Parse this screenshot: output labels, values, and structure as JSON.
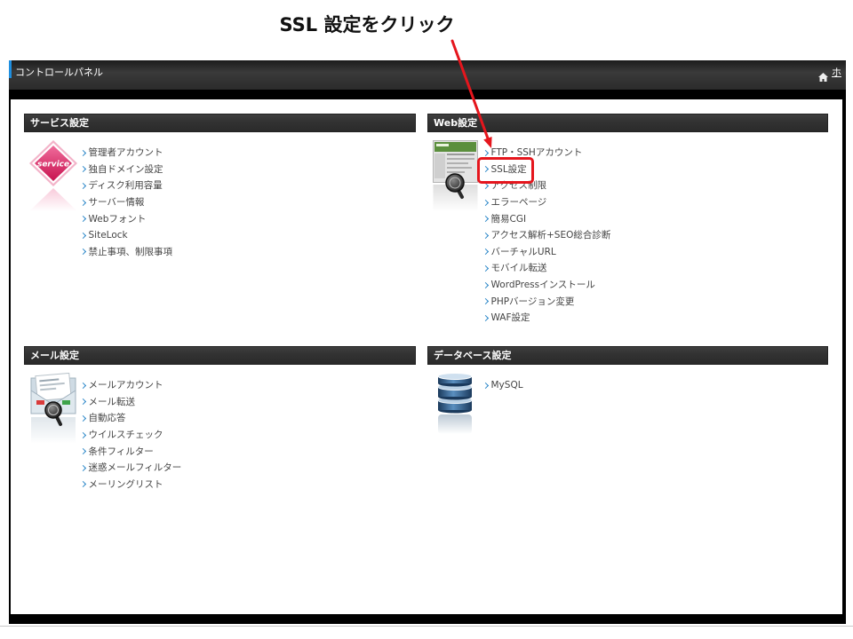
{
  "annotation": {
    "instruction": "SSL 設定をクリック"
  },
  "header": {
    "title": "コントロールパネル",
    "home_icon": "home-icon",
    "home_link": "ホ"
  },
  "sections": {
    "service": {
      "title": "サービス設定",
      "icon": "service-diamond-icon",
      "icon_text": "service",
      "links": [
        "管理者アカウント",
        "独自ドメイン設定",
        "ディスク利用容量",
        "サーバー情報",
        "Webフォント",
        "SiteLock",
        "禁止事項、制限事項"
      ]
    },
    "web": {
      "title": "Web設定",
      "icon": "web-page-magnifier-icon",
      "highlighted_link_index": 1,
      "links": [
        "FTP・SSHアカウント",
        "SSL設定",
        "アクセス制限",
        "エラーページ",
        "簡易CGI",
        "アクセス解析+SEO総合診断",
        "バーチャルURL",
        "モバイル転送",
        "WordPressインストール",
        "PHPバージョン変更",
        "WAF設定"
      ]
    },
    "mail": {
      "title": "メール設定",
      "icon": "mail-envelope-icon",
      "links": [
        "メールアカウント",
        "メール転送",
        "自動応答",
        "ウイルスチェック",
        "条件フィルター",
        "迷惑メールフィルター",
        "メーリングリスト"
      ]
    },
    "database": {
      "title": "データベース設定",
      "icon": "database-icon",
      "links": [
        "MySQL"
      ]
    }
  },
  "colors": {
    "annotation_red": "#e5161d",
    "link_chevron": "#2a86c8",
    "link_text": "#444444",
    "section_bar": "#333333",
    "header_accent": "#1f8fe0",
    "frame": "#000000"
  }
}
